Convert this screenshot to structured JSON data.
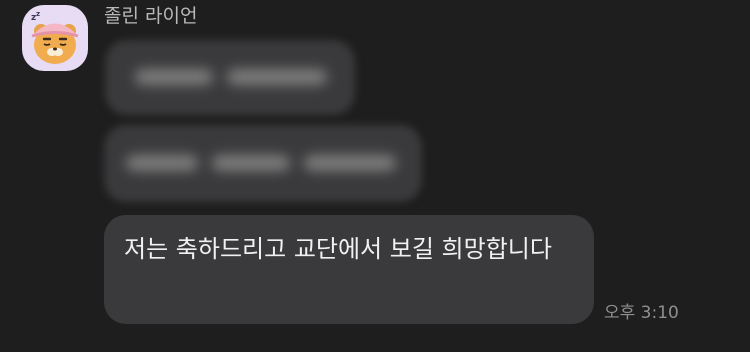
{
  "chat": {
    "sender_name": "졸린 라이언",
    "avatar_icon": "sleepy-ryan-character-icon",
    "messages": [
      {
        "blurred": true
      },
      {
        "blurred": true
      },
      {
        "text": "저는 축하드리고 교단에서 보길 희망합니다"
      }
    ],
    "timestamp": "오후 3:10"
  },
  "colors": {
    "background": "#1e1e1e",
    "bubble": "#3a3a3c",
    "text": "#f1f1f1",
    "muted": "#8f8f8f",
    "avatar_bg": "#e8dcf5"
  }
}
